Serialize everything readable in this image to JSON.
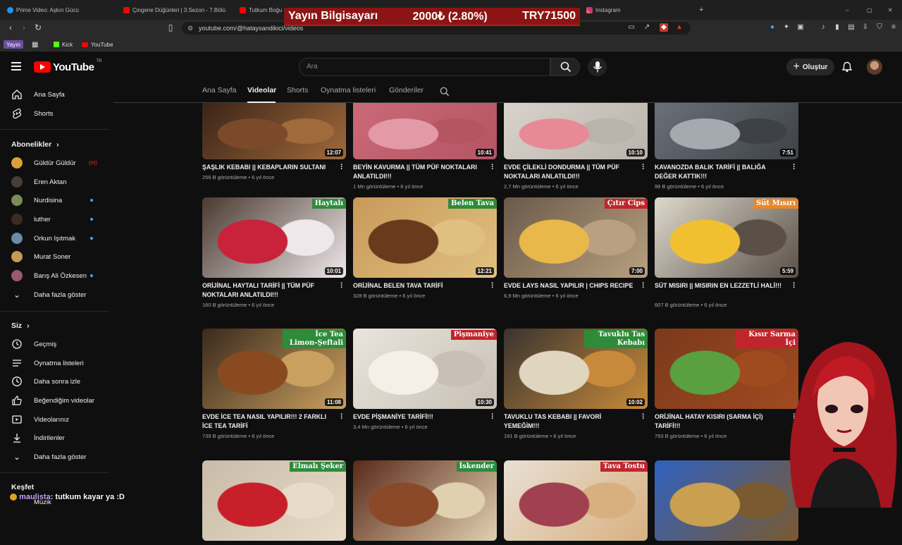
{
  "browser": {
    "tabs": [
      {
        "title": "Prime Video: Aşkın Gücü",
        "color": "#1a98ff"
      },
      {
        "title": "Çingene Düğünleri | 3.Sezon - 7.Bölü",
        "color": "#ff0000"
      },
      {
        "title": "Tutkum Boğu",
        "color": "#ff0000"
      },
      {
        "title": "Instagram",
        "color": "#e1306c"
      }
    ],
    "url": "youtube.com/@hataysandikici/videos",
    "bookmarks": [
      {
        "label": "Yayın"
      },
      {
        "label": "Kick",
        "color": "#53fc18"
      },
      {
        "label": "YouTube",
        "color": "#ff0000"
      }
    ]
  },
  "ticker": {
    "left": "Yayın Bilgisayarı",
    "middle": "2000₺ (2.80%)",
    "right": "TRY71500"
  },
  "header": {
    "logo_text": "YouTube",
    "logo_sup": "TR",
    "search_placeholder": "Ara",
    "create_label": "Oluştur"
  },
  "sidebar": {
    "main": [
      {
        "label": "Ana Sayfa",
        "icon": "home-icon"
      },
      {
        "label": "Shorts",
        "icon": "shorts-icon"
      }
    ],
    "subs_title": "Abonelikler",
    "subscriptions": [
      {
        "label": "Güldür Güldür",
        "status": "live",
        "color": "#d9a13a"
      },
      {
        "label": "Eren Aktan",
        "status": "",
        "color": "#4a3c36"
      },
      {
        "label": "Nurdisina",
        "status": "new",
        "color": "#7a8c5a"
      },
      {
        "label": "luther",
        "status": "new",
        "color": "#3c2c24"
      },
      {
        "label": "Orkun Işıtmak",
        "status": "new",
        "color": "#6a8aa8"
      },
      {
        "label": "Murat Soner",
        "status": "",
        "color": "#c49a54"
      },
      {
        "label": "Barış Ali Özkesen",
        "status": "new",
        "color": "#9a5a6a"
      }
    ],
    "show_more": "Daha fazla göster",
    "you_title": "Siz",
    "you": [
      {
        "label": "Geçmiş",
        "icon": "history-icon"
      },
      {
        "label": "Oynatma listeleri",
        "icon": "playlists-icon"
      },
      {
        "label": "Daha sonra izle",
        "icon": "watch-later-icon"
      },
      {
        "label": "Beğendiğim videolar",
        "icon": "like-icon"
      },
      {
        "label": "Videolarınız",
        "icon": "your-videos-icon"
      },
      {
        "label": "İndirilenler",
        "icon": "downloads-icon"
      },
      {
        "label": "Daha fazla göster",
        "icon": "chevron-down-icon"
      }
    ],
    "explore_title": "Keşfet",
    "explore_first": "Müzik"
  },
  "channel_tabs": [
    {
      "label": "Ana Sayfa",
      "active": false
    },
    {
      "label": "Videolar",
      "active": true
    },
    {
      "label": "Shorts",
      "active": false
    },
    {
      "label": "Oynatma listeleri",
      "active": false
    },
    {
      "label": "Gönderiler",
      "active": false
    }
  ],
  "videos": [
    {
      "title": "ŞAŞLIK KEBABI || KEBAPLARIN SULTANI",
      "views": "256 B görüntüleme",
      "age": "6 yıl önce",
      "duration": "12:07",
      "badge": "",
      "badge_color": "",
      "colors": [
        "#3a2418",
        "#7a4a2a",
        "#a06a3a"
      ]
    },
    {
      "title": "BEYİN KAVURMA || TÜM PÜF NOKTALARI ANLATILDI!!!",
      "views": "1 Mn görüntüleme",
      "age": "6 yıl önce",
      "duration": "10:41",
      "badge": "",
      "badge_color": "",
      "colors": [
        "#c96a78",
        "#e39aa6",
        "#b55462"
      ]
    },
    {
      "title": "EVDE ÇİLEKLİ DONDURMA || TÜM PÜF NOKTALARI ANLATILDI!!!",
      "views": "2,7 Mn görüntüleme",
      "age": "6 yıl önce",
      "duration": "10:10",
      "badge": "",
      "badge_color": "",
      "colors": [
        "#d8d2cc",
        "#e78a96",
        "#b9b3ab"
      ]
    },
    {
      "title": "KAVANOZDA BALIK TARİFİ || BALIĞA DEĞER KATTIK!!!",
      "views": "99 B görüntüleme",
      "age": "6 yıl önce",
      "duration": "7:51",
      "badge": "",
      "badge_color": "",
      "colors": [
        "#6a7078",
        "#a4aab0",
        "#3e4248"
      ]
    },
    {
      "title": "ORİJİNAL HAYTALI TARİFİ || TÜM PÜF NOKTALARI ANLATILDI!!!",
      "views": "160 B görüntüleme",
      "age": "6 yıl önce",
      "duration": "10:01",
      "badge": "Haytalı",
      "badge_color": "green",
      "colors": [
        "#4a3a30",
        "#c8233a",
        "#efe8ea"
      ]
    },
    {
      "title": "ORİJİNAL BELEN TAVA TARİFİ",
      "views": "328 B görüntüleme",
      "age": "6 yıl önce",
      "duration": "12:21",
      "badge": "Belen Tava",
      "badge_color": "green",
      "colors": [
        "#c89a5a",
        "#6a3a1c",
        "#e0c080"
      ]
    },
    {
      "title": "EVDE LAYS NASIL YAPILIR | Chips Recipe",
      "views": "6,9 Mn görüntüleme",
      "age": "6 yıl önce",
      "duration": "7:00",
      "badge": "Çıtır Cips",
      "badge_color": "red",
      "colors": [
        "#6a5a4a",
        "#e8b84a",
        "#b8a080"
      ]
    },
    {
      "title": "SÜT MISIRI || MISIRIN EN LEZZETLİ HALİ!!!",
      "views": "607 B görüntüleme",
      "age": "6 yıl önce",
      "duration": "5:59",
      "badge": "Süt Mısırı",
      "badge_color": "orange",
      "colors": [
        "#ddd8cc",
        "#f0c030",
        "#5a5048"
      ]
    },
    {
      "title": "EVDE İCE TEA NASIL YAPILIR!!! 2 FARKLI İCE TEA TARİFİ",
      "views": "739 B görüntüleme",
      "age": "6 yıl önce",
      "duration": "11:08",
      "badge": "İce Tea Limon-Şeftali",
      "badge_color": "green",
      "colors": [
        "#3a2a1c",
        "#8a4a20",
        "#c9a060"
      ]
    },
    {
      "title": "EVDE PİŞMANİYE TARİFİ!!!",
      "views": "3,4 Mn görüntüleme",
      "age": "6 yıl önce",
      "duration": "10:30",
      "badge": "Pişmaniye",
      "badge_color": "red",
      "colors": [
        "#e8e4dc",
        "#f4f0e8",
        "#c8c0b4"
      ]
    },
    {
      "title": "TAVUKLU TAS KEBABI || FAVORİ YEMEĞİM!!!",
      "views": "191 B görüntüleme",
      "age": "6 yıl önce",
      "duration": "10:02",
      "badge": "Tavuklu Tas Kebabı",
      "badge_color": "green",
      "colors": [
        "#3a3430",
        "#e0d6c0",
        "#c88a3a"
      ]
    },
    {
      "title": "ORİJİNAL HATAY KISIRI (SARMA İÇİ) TARİFİ!!!",
      "views": "793 B görüntüleme",
      "age": "6 yıl önce",
      "duration": "",
      "badge": "Kısır Sarma İçi",
      "badge_color": "red",
      "colors": [
        "#7a3a1c",
        "#5aa040",
        "#a04a20"
      ]
    },
    {
      "title": "",
      "views": "",
      "age": "",
      "duration": "",
      "badge": "Elmalı Şeker",
      "badge_color": "green",
      "colors": [
        "#c8bca8",
        "#c8202a",
        "#e8dcc8"
      ]
    },
    {
      "title": "",
      "views": "",
      "age": "",
      "duration": "",
      "badge": "İskender",
      "badge_color": "green",
      "colors": [
        "#5a2a1a",
        "#8a4a2a",
        "#e0d0b0"
      ]
    },
    {
      "title": "",
      "views": "",
      "age": "",
      "duration": "",
      "badge": "Tava Tostu",
      "badge_color": "red",
      "colors": [
        "#e8e0d4",
        "#a04050",
        "#d8b080"
      ]
    },
    {
      "title": "",
      "views": "",
      "age": "",
      "duration": "",
      "badge": "",
      "badge_color": "",
      "colors": [
        "#3060c0",
        "#c8a050",
        "#7a5a30"
      ]
    }
  ],
  "chat": {
    "user": "maulista",
    "message": ": tutkum kayar ya :D"
  }
}
